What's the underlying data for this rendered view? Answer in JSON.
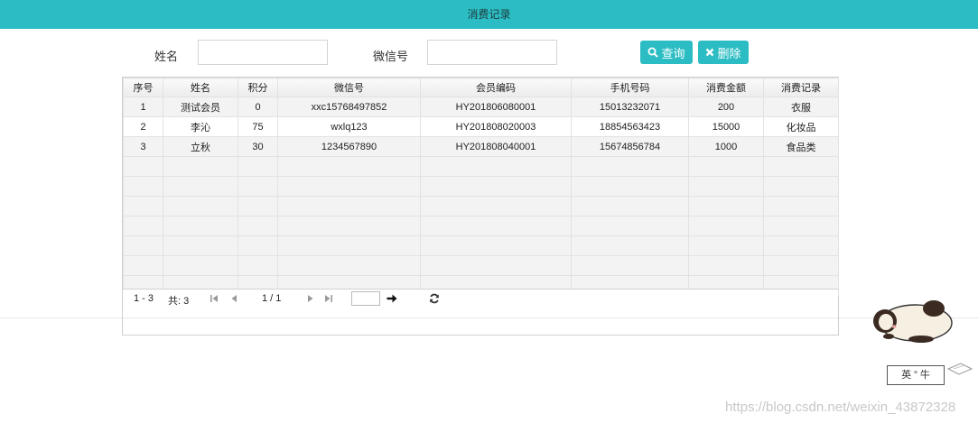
{
  "header": {
    "title": "消费记录"
  },
  "search": {
    "name_label": "姓名",
    "name_value": "",
    "name_placeholder": "",
    "wechat_label": "微信号",
    "wechat_value": "",
    "wechat_placeholder": "",
    "query_label": "查询",
    "delete_label": "删除"
  },
  "table": {
    "columns": [
      "序号",
      "姓名",
      "积分",
      "微信号",
      "会员编码",
      "手机号码",
      "消费金额",
      "消费记录"
    ],
    "rows": [
      [
        "1",
        "测试会员",
        "0",
        "xxc15768497852",
        "HY201806080001",
        "15013232071",
        "200",
        "衣服"
      ],
      [
        "2",
        "李沁",
        "75",
        "wxlq123",
        "HY201808020003",
        "18854563423",
        "15000",
        "化妆品"
      ],
      [
        "3",
        "立秋",
        "30",
        "1234567890",
        "HY201808040001",
        "15674856784",
        "1000",
        "食品类"
      ]
    ]
  },
  "pager": {
    "range": "1 - 3",
    "total": "共: 3",
    "page": "1 / 1",
    "goto_value": ""
  },
  "branding": {
    "stamp_text": "英  ” 牛",
    "watermark": "https://blog.csdn.net/weixin_43872328"
  },
  "colors": {
    "accent": "#2bbdc3"
  },
  "icons": {
    "query": "search-icon",
    "delete": "close-icon",
    "first": "first-page-icon",
    "prev": "prev-page-icon",
    "next": "next-page-icon",
    "last": "last-page-icon",
    "go": "arrow-right-icon",
    "refresh": "refresh-icon"
  }
}
